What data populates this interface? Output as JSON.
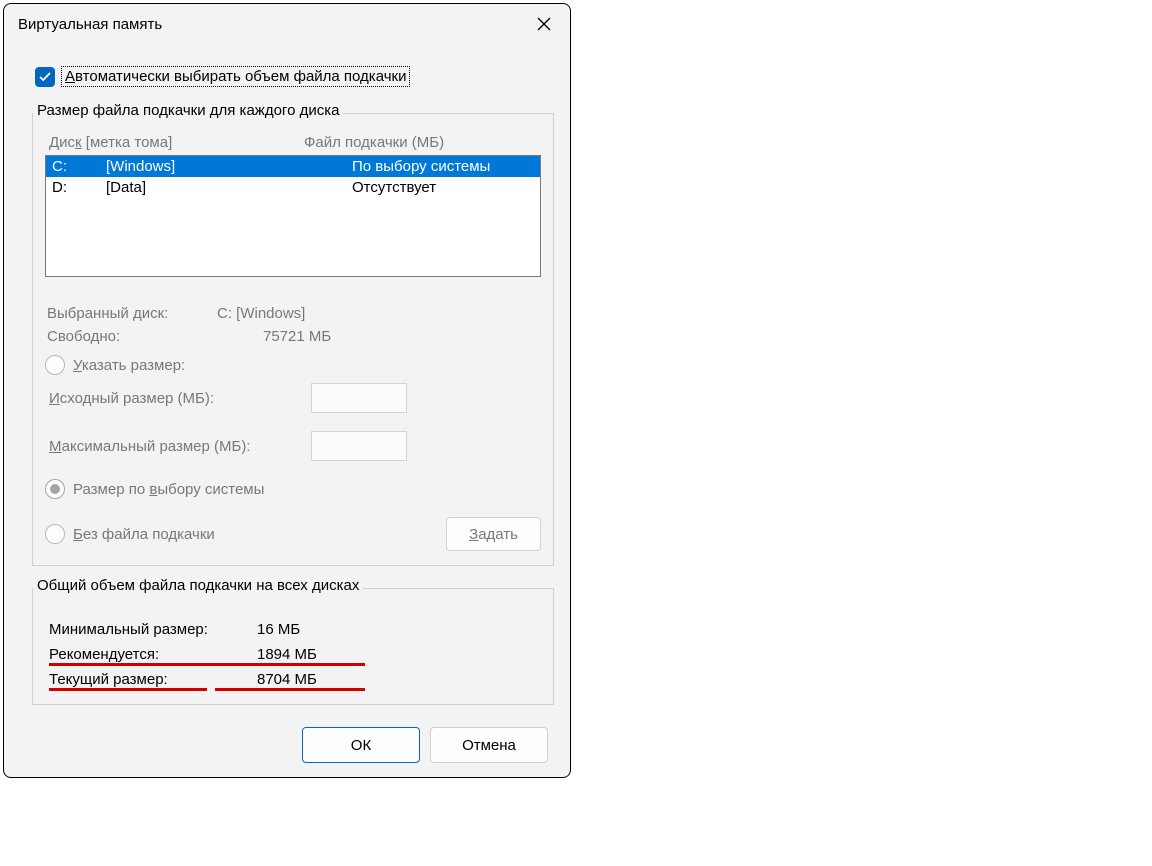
{
  "dialog": {
    "title": "Виртуальная память",
    "auto_checkbox": {
      "prefix": "А",
      "rest": "втоматически выбирать объем файла подкачки"
    }
  },
  "drives_group": {
    "title": "Размер файла подкачки для каждого диска",
    "header": {
      "disk_prefix": "Дис",
      "disk_u": "к",
      "disk_suffix": " [метка тома]",
      "paging": "Файл подкачки (МБ)"
    },
    "rows": [
      {
        "letter": "C:",
        "label": "[Windows]",
        "pf": "По выбору системы",
        "selected": true
      },
      {
        "letter": "D:",
        "label": "[Data]",
        "pf": "Отсутствует",
        "selected": false
      }
    ],
    "selected_drive_label": "Выбранный диск:",
    "selected_drive_value": "C:  [Windows]",
    "free_label": "Свободно:",
    "free_value": "75721 МБ",
    "custom": {
      "u": "У",
      "rest": "казать размер:"
    },
    "initial": {
      "u": "И",
      "rest": "сходный размер (МБ):"
    },
    "max": {
      "u": "М",
      "rest": "аксимальный размер (МБ):"
    },
    "system_managed": {
      "prefix": "Размер по ",
      "u": "в",
      "rest": "ыбору системы"
    },
    "no_pf": {
      "u": "Б",
      "rest": "ез файла подкачки"
    },
    "set_btn": {
      "u": "З",
      "rest": "адать"
    }
  },
  "totals_group": {
    "title": "Общий объем файла подкачки на всех дисках",
    "min_label": "Минимальный размер:",
    "min_value": "16 МБ",
    "rec_label": "Рекомендуется:",
    "rec_value": "1894 МБ",
    "cur_label": "Текущий размер:",
    "cur_value": "8704 МБ"
  },
  "footer": {
    "ok": "ОК",
    "cancel": "Отмена"
  }
}
